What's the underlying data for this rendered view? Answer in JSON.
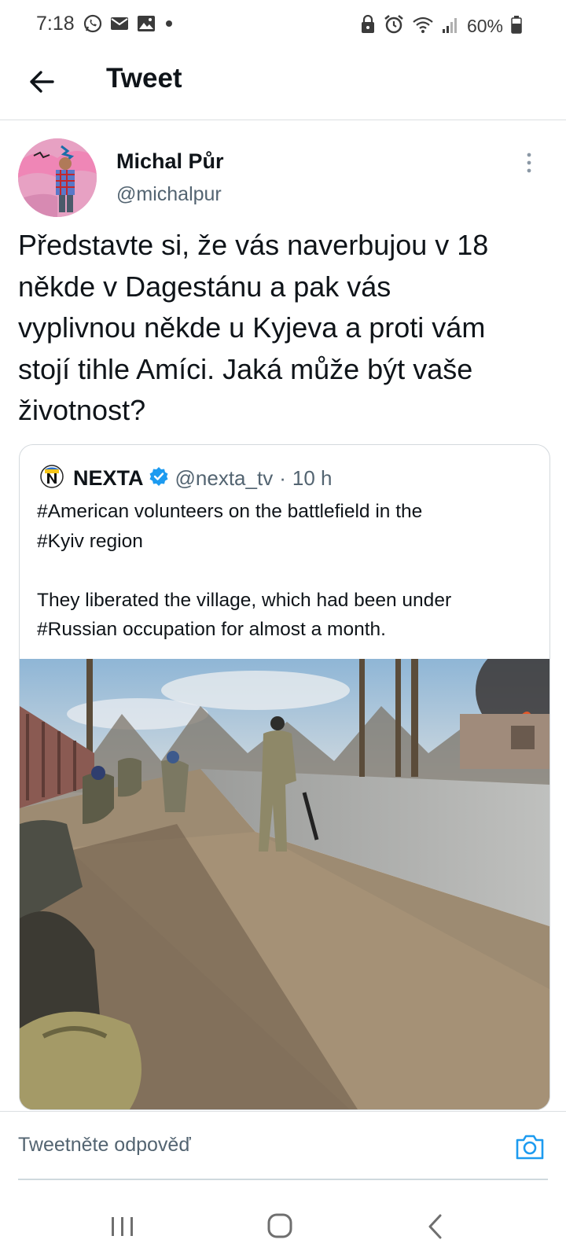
{
  "status_bar": {
    "time": "7:18",
    "battery": "60%",
    "left_icons": [
      "whatsapp-icon",
      "mail-icon",
      "gallery-icon",
      "dot-icon"
    ],
    "right_icons": [
      "lock-icon",
      "alarm-icon",
      "wifi-icon",
      "signal-icon",
      "battery-icon"
    ]
  },
  "header": {
    "title": "Tweet"
  },
  "tweet": {
    "author_name": "Michal Půr",
    "author_handle": "@michalpur",
    "text": "Představte si, že vás naverbujou v 18\nněkde v Dagestánu a pak vás\nvyplivnou někde u Kyjeva a proti vám\nstojí tihle Amíci. Jaká může být vaše\nživotnost?"
  },
  "quoted_tweet": {
    "author_name": "NEXTA",
    "author_handle": "@nexta_tv",
    "separator": "·",
    "time_ago": "10 h",
    "text": "#American volunteers on the battlefield in the\n#Kyiv region\n\nThey liberated the village, which had been under\n#Russian occupation for almost a month."
  },
  "reply": {
    "placeholder": "Tweetněte odpověď"
  },
  "colors": {
    "accent": "#1d9bf0",
    "text_primary": "#0f1419",
    "text_secondary": "#536471",
    "divider": "#dcdfe2"
  }
}
